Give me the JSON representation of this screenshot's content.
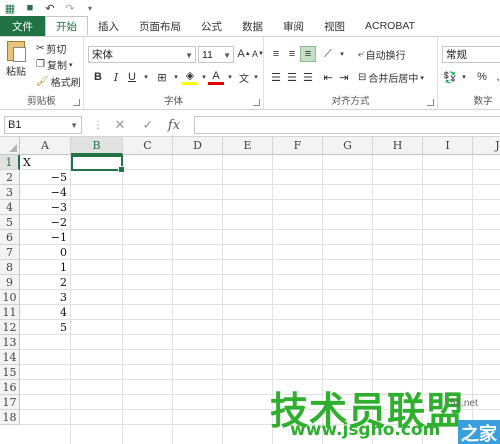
{
  "tabs": [
    "文件",
    "开始",
    "插入",
    "页面布局",
    "公式",
    "数据",
    "审阅",
    "视图",
    "ACROBAT"
  ],
  "clipboard": {
    "paste": "粘贴",
    "cut": "剪切",
    "copy": "复制",
    "format_painter": "格式刷",
    "group_label": "剪贴板"
  },
  "font": {
    "name": "宋体",
    "size": "11",
    "bold": "B",
    "italic": "I",
    "underline": "U",
    "text_color_letter": "A",
    "group_label": "字体"
  },
  "alignment": {
    "wrap_text": "自动换行",
    "merge_center": "合并后居中",
    "group_label": "对齐方式"
  },
  "number": {
    "format": "常规",
    "percent": "%",
    "group_label": "数字"
  },
  "formula_bar": {
    "name_box": "B1",
    "fx": "fx",
    "content": ""
  },
  "columns": [
    "A",
    "B",
    "C",
    "D",
    "E",
    "F",
    "G",
    "H",
    "I",
    "J"
  ],
  "rows": [
    "1",
    "2",
    "3",
    "4",
    "5",
    "6",
    "7",
    "8",
    "9",
    "10",
    "11",
    "12",
    "13",
    "14",
    "15",
    "16",
    "17",
    "18"
  ],
  "cells_A": [
    "X",
    "−5",
    "−4",
    "−3",
    "−2",
    "−1",
    "0",
    "1",
    "2",
    "3",
    "4",
    "5"
  ],
  "watermark": {
    "main": "技术员联盟",
    "url": "www.jsgho.com",
    "side": "51.net",
    "side2": "之家"
  }
}
